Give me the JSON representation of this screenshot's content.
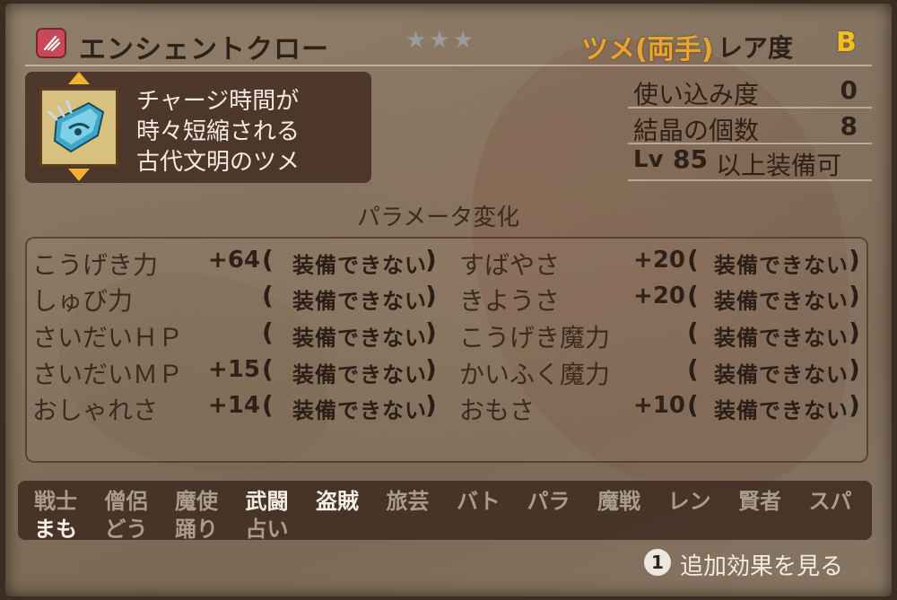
{
  "item": {
    "name": "エンシェントクロー",
    "stars": "★★★",
    "type": "ツメ(両手)",
    "rarity_label": "レア度",
    "rarity_grade": "B",
    "description": [
      "チャージ時間が",
      "時々短縮される",
      "古代文明のツメ"
    ],
    "icon": "blue-claw-icon"
  },
  "stats": {
    "usage_label": "使い込み度",
    "usage_value": "0",
    "crystal_label": "結晶の個数",
    "crystal_value": "8",
    "lv_label": "Lv",
    "lv_value": "85",
    "lv_suffix": "以上装備可"
  },
  "params": {
    "title": "パラメータ変化",
    "cannot_equip": "装備できない",
    "left": [
      {
        "name": "こうげき力",
        "mod": "+64"
      },
      {
        "name": "しゅび力",
        "mod": ""
      },
      {
        "name": "さいだいＨＰ",
        "mod": ""
      },
      {
        "name": "さいだいＭＰ",
        "mod": "+15"
      },
      {
        "name": "おしゃれさ",
        "mod": "+14"
      }
    ],
    "right": [
      {
        "name": "すばやさ",
        "mod": "+20"
      },
      {
        "name": "きようさ",
        "mod": "+20"
      },
      {
        "name": "こうげき魔力",
        "mod": ""
      },
      {
        "name": "かいふく魔力",
        "mod": ""
      },
      {
        "name": "おもさ",
        "mod": "+10"
      }
    ]
  },
  "jobs": {
    "row1": [
      {
        "label": "戦士",
        "enabled": false
      },
      {
        "label": "僧侶",
        "enabled": false
      },
      {
        "label": "魔使",
        "enabled": false
      },
      {
        "label": "武闘",
        "enabled": true
      },
      {
        "label": "盗賊",
        "enabled": true
      },
      {
        "label": "旅芸",
        "enabled": false
      },
      {
        "label": "バト",
        "enabled": false
      },
      {
        "label": "パラ",
        "enabled": false
      },
      {
        "label": "魔戦",
        "enabled": false
      },
      {
        "label": "レン",
        "enabled": false
      },
      {
        "label": "賢者",
        "enabled": false
      },
      {
        "label": "スパ",
        "enabled": false
      }
    ],
    "row2": [
      {
        "label": "まも",
        "enabled": true
      },
      {
        "label": "どう",
        "enabled": false
      },
      {
        "label": "踊り",
        "enabled": false
      },
      {
        "label": "占い",
        "enabled": false
      }
    ]
  },
  "footer": {
    "button_glyph": "1",
    "button_label": "追加効果を見る"
  },
  "colors": {
    "type_accent": "#e8a530",
    "rarity_accent": "#f0c020",
    "job_enabled": "#f6f0e4",
    "job_disabled": "#a89c8c"
  }
}
